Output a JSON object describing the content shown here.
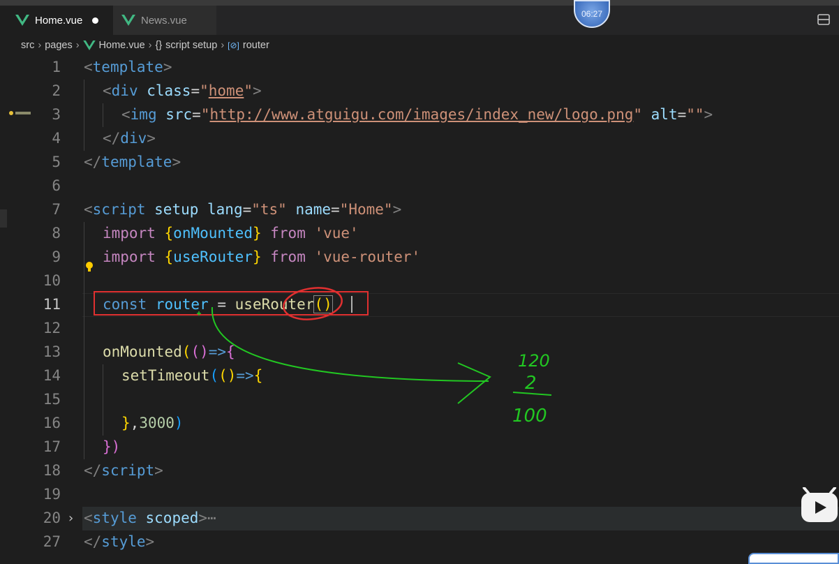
{
  "tabs": [
    {
      "label": "Home.vue",
      "active": true,
      "modified": true
    },
    {
      "label": "News.vue",
      "active": false,
      "modified": false
    }
  ],
  "timer": "06:27",
  "breadcrumb": {
    "items": [
      "src",
      "pages",
      "Home.vue",
      "script setup",
      "router"
    ],
    "icons": [
      "",
      "",
      "vue-icon",
      "braces-icon",
      "variable-icon"
    ]
  },
  "lines": {
    "l1": {
      "num": "1",
      "t1": "<",
      "t2": "template",
      "t3": ">"
    },
    "l2": {
      "num": "2",
      "t1": "<",
      "t2": "div",
      "t3": " class",
      "t4": "=",
      "t5": "\"",
      "t6": "home",
      "t7": "\"",
      "t8": ">"
    },
    "l3": {
      "num": "3",
      "t1": "<",
      "t2": "img",
      "t3": " src",
      "t4": "=",
      "t5": "\"",
      "t6": "http://www.atguigu.com/images/index_new/logo.png",
      "t7": "\"",
      "t8": " alt",
      "t9": "=",
      "t10": "\"\"",
      "t11": ">"
    },
    "l4": {
      "num": "4",
      "t1": "</",
      "t2": "div",
      "t3": ">"
    },
    "l5": {
      "num": "5",
      "t1": "</",
      "t2": "template",
      "t3": ">"
    },
    "l6": {
      "num": "6"
    },
    "l7": {
      "num": "7",
      "t1": "<",
      "t2": "script",
      "t3": " setup",
      "t4": " lang",
      "t5": "=",
      "t6": "\"ts\"",
      "t7": " name",
      "t8": "=",
      "t9": "\"Home\"",
      "t10": ">"
    },
    "l8": {
      "num": "8",
      "t1": "import ",
      "t2": "{",
      "t3": "onMounted",
      "t4": "}",
      "t5": " from ",
      "t6": "'vue'"
    },
    "l9": {
      "num": "9",
      "t1": "import ",
      "t2": "{",
      "t3": "useRouter",
      "t4": "}",
      "t5": " from ",
      "t6": "'vue-router'"
    },
    "l10": {
      "num": "10"
    },
    "l11": {
      "num": "11",
      "t1": "const ",
      "t2": "router",
      "t3": " = ",
      "t4": "useRouter",
      "t5": "()"
    },
    "l12": {
      "num": "12"
    },
    "l13": {
      "num": "13",
      "t1": "onMounted",
      "t2": "(",
      "t3": "()",
      "t4": "=>",
      "t5": "{"
    },
    "l14": {
      "num": "14",
      "t1": "setTimeout",
      "t2": "(",
      "t3": "()",
      "t4": "=>",
      "t5": "{"
    },
    "l15": {
      "num": "15"
    },
    "l16": {
      "num": "16",
      "t1": "}",
      "t2": ",",
      "t3": "3000",
      "t4": ")"
    },
    "l17": {
      "num": "17",
      "t1": "})"
    },
    "l18": {
      "num": "18",
      "t1": "</",
      "t2": "script",
      "t3": ">"
    },
    "l19": {
      "num": "19"
    },
    "l20": {
      "num": "20",
      "t1": "<",
      "t2": "style",
      "t3": " scoped",
      "t4": ">",
      "t5": "⋯"
    },
    "l27": {
      "num": "27",
      "t1": "</",
      "t2": "style",
      "t3": ">"
    }
  },
  "handwriting": {
    "top": "120",
    "middle": "2",
    "bottom": "100"
  },
  "colors": {
    "annotation_red": "#e03030",
    "handwriting_green": "#22c722"
  }
}
